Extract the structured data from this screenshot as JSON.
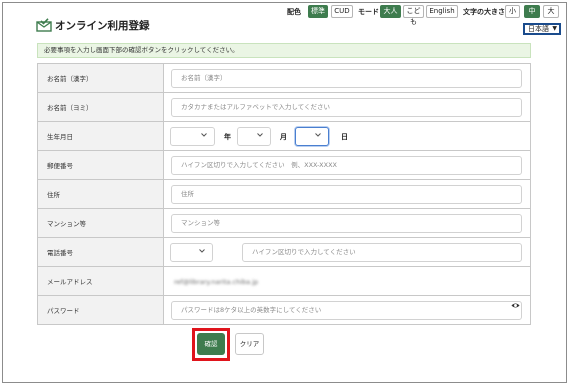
{
  "header": {
    "title": "オンライン利用登録",
    "logo_icon": "envelope-check-icon"
  },
  "controls": {
    "color_label": "配色",
    "color_options": [
      "標準",
      "CUD"
    ],
    "mode_label": "モード",
    "mode_options": [
      "大人",
      "こども",
      "English"
    ],
    "font_size_label": "文字の大きさ",
    "font_size_options": [
      "小",
      "中",
      "大"
    ],
    "language": "日本語"
  },
  "notice": "必要事項を入力し画面下部の確認ボタンをクリックしてください。",
  "form": {
    "name_kanji": {
      "label": "お名前（漢字）",
      "placeholder": "お名前（漢字）"
    },
    "name_kana": {
      "label": "お名前（ヨミ）",
      "placeholder": "カタカナまたはアルファベットで入力してください"
    },
    "birthdate": {
      "label": "生年月日",
      "year_unit": "年",
      "month_unit": "月",
      "day_unit": "日"
    },
    "postal": {
      "label": "郵便番号",
      "placeholder": "ハイフン区切りで入力してください　例、XXX-XXXX"
    },
    "address": {
      "label": "住所",
      "placeholder": "住所"
    },
    "building": {
      "label": "マンション等",
      "placeholder": "マンション等"
    },
    "phone": {
      "label": "電話番号",
      "placeholder": "ハイフン区切りで入力してください"
    },
    "email": {
      "label": "メールアドレス",
      "value": "ref@library.narita.chiba.jp"
    },
    "password": {
      "label": "パスワード",
      "placeholder": "パスワードは8ケタ以上の英数字にしてください"
    }
  },
  "buttons": {
    "confirm": "確認",
    "clear": "クリア"
  },
  "colors": {
    "accent": "#3e7c4e",
    "highlight": "#e0141c",
    "notice_bg": "#eaf5e4"
  }
}
